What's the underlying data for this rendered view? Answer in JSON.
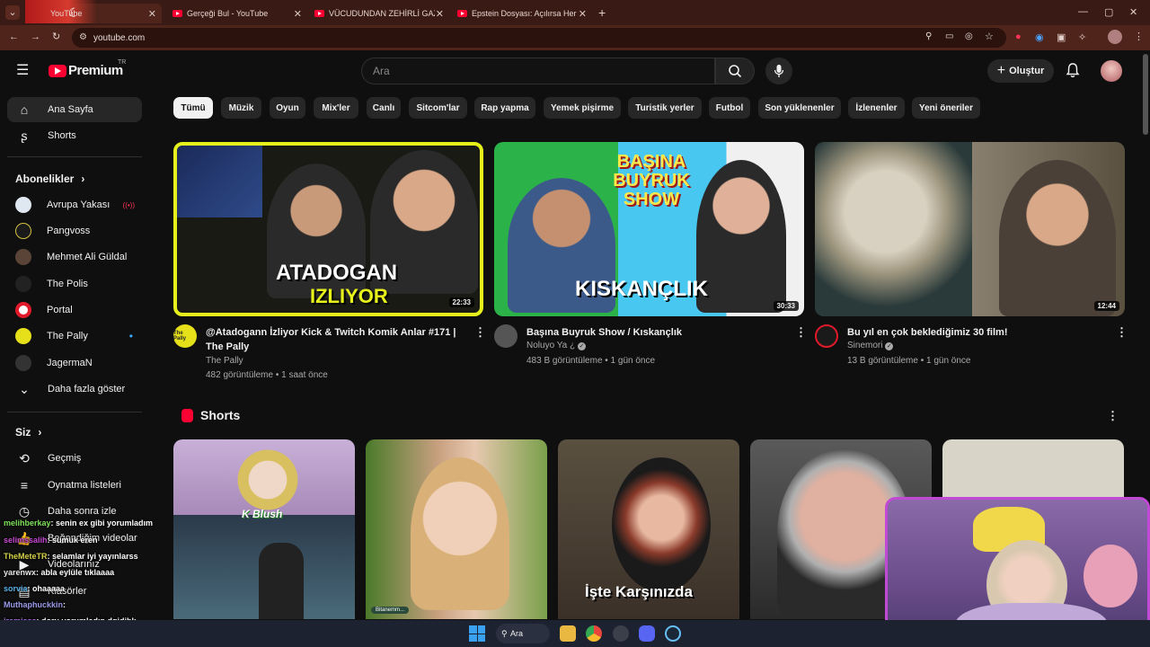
{
  "browser": {
    "tabs": [
      {
        "title": "YouTube"
      },
      {
        "title": "Gerçeği Bul - YouTube"
      },
      {
        "title": "VÜCUDUNDAN ZEHİRLİ GAZ S..."
      },
      {
        "title": "Epstein Dosyası: Açılırsa Her Şe..."
      }
    ],
    "new_tab": "+",
    "url": "youtube.com"
  },
  "header": {
    "logo_text": "Premium",
    "region": "TR",
    "search_placeholder": "Ara",
    "create_label": "Oluştur"
  },
  "sidebar": {
    "main": [
      {
        "label": "Ana Sayfa"
      },
      {
        "label": "Shorts"
      }
    ],
    "subs_title": "Abonelikler",
    "subs": [
      {
        "label": "Avrupa Yakası",
        "live": "((•))"
      },
      {
        "label": "Pangvoss"
      },
      {
        "label": "Mehmet Ali Güldal"
      },
      {
        "label": "The Polis"
      },
      {
        "label": "Portal"
      },
      {
        "label": "The Pally",
        "dot": "•"
      },
      {
        "label": "JagermaN"
      }
    ],
    "more_label": "Daha fazla göster",
    "you_title": "Siz",
    "you": [
      {
        "label": "Geçmiş"
      },
      {
        "label": "Oynatma listeleri"
      },
      {
        "label": "Daha sonra izle"
      },
      {
        "label": "Beğendiğim videolar"
      },
      {
        "label": "Videolarınız"
      },
      {
        "label": "Klasörler"
      }
    ]
  },
  "chips": [
    "Tümü",
    "Müzik",
    "Oyun",
    "Mix'ler",
    "Canlı",
    "Sitcom'lar",
    "Rap yapma",
    "Yemek pişirme",
    "Turistik yerler",
    "Futbol",
    "Son yüklenenler",
    "İzlenenler",
    "Yeni öneriler"
  ],
  "videos": [
    {
      "title": "@Atadogann İzliyor Kick & Twitch Komik Anlar #171 | The Pally",
      "channel": "The Pally",
      "meta": "482 görüntüleme • 1 saat önce",
      "duration": "22:33",
      "thumb_text_1": "ATADOGAN",
      "thumb_text_2": "IZLIYOR",
      "avatar_text": "The Pally"
    },
    {
      "title": "Başına Buyruk Show / Kıskançlık",
      "channel": "Noluyo Ya ¿",
      "meta": "483 B görüntüleme • 1 gün önce",
      "duration": "30:33",
      "thumb_text_1": "BAŞINA BUYRUK SHOW",
      "thumb_text_2": "KISKANÇLIK"
    },
    {
      "title": "Bu yıl en çok beklediğimiz 30 film!",
      "channel": "Sinemori",
      "meta": "13 B görüntüleme • 1 gün önce",
      "duration": "12:44"
    }
  ],
  "shorts": {
    "title": "Shorts",
    "items": [
      {
        "overlay": "K Blush"
      },
      {
        "overlay": "Bitanemm..."
      },
      {
        "overlay": "İşte Karşınızda"
      },
      {
        "overlay": ""
      },
      {
        "overlay": ""
      }
    ]
  },
  "chat": [
    {
      "user": "melihberkay",
      "msg": ": senin ex gibi yorumladım",
      "color": "#7ee25a"
    },
    {
      "user": "selimssalih",
      "msg": ": sumuk eren",
      "color": "#c84ad4"
    },
    {
      "user": "TheMeteTR",
      "msg": ": selamlar iyi yayınlarss",
      "color": "#d5d24a"
    },
    {
      "user": "yarenwx",
      "msg": ": abla eylüle tıklaaaa",
      "color": "#e8e8e8"
    },
    {
      "user": "sorvia",
      "msg": ": ohaaaaa",
      "color": "#5ab2e8"
    },
    {
      "user": "Muthaphuckkin",
      "msg": ":",
      "color": "#9a9ae8"
    },
    {
      "user": "iremisss",
      "msg": ": doru yorumladın dgjdjhk",
      "color": "#b070e8"
    }
  ],
  "taskbar": {
    "search_label": "Ara"
  },
  "colors": {
    "accent": "#ff0033",
    "bg": "#0f0f0f",
    "chip": "#272727",
    "tabbar": "#3a1a14"
  }
}
